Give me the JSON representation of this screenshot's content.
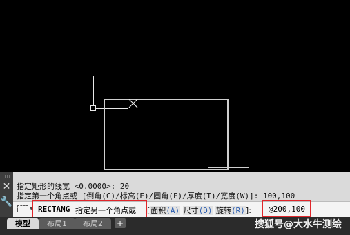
{
  "history": {
    "line1": "指定矩形的线宽 <0.0000>: 20",
    "line2": "指定第一个角点或 [倒角(C)/标高(E)/圆角(F)/厚度(T)/宽度(W)]: 100,100"
  },
  "command": {
    "name": "RECTANG",
    "prompt": "指定另一个角点或",
    "options": [
      {
        "label": "面积",
        "key": "(A)"
      },
      {
        "label": "尺寸",
        "key": "(D)"
      },
      {
        "label": "旋转",
        "key": "(R)"
      }
    ],
    "suffix": "]:",
    "input_value": "@200,100"
  },
  "tabs": [
    {
      "label": "模型",
      "active": true
    },
    {
      "label": "布局1",
      "active": false
    },
    {
      "label": "布局2",
      "active": false
    }
  ],
  "add_tab": "+",
  "watermark": "搜狐号@大水牛测绘",
  "colors": {
    "highlight": "#e0262b",
    "option_key": "#2a5db0"
  },
  "icons": {
    "close": "close-icon",
    "settings": "wrench-icon",
    "prompt": "rectangle-icon",
    "cursor": "crosshair-icon"
  }
}
